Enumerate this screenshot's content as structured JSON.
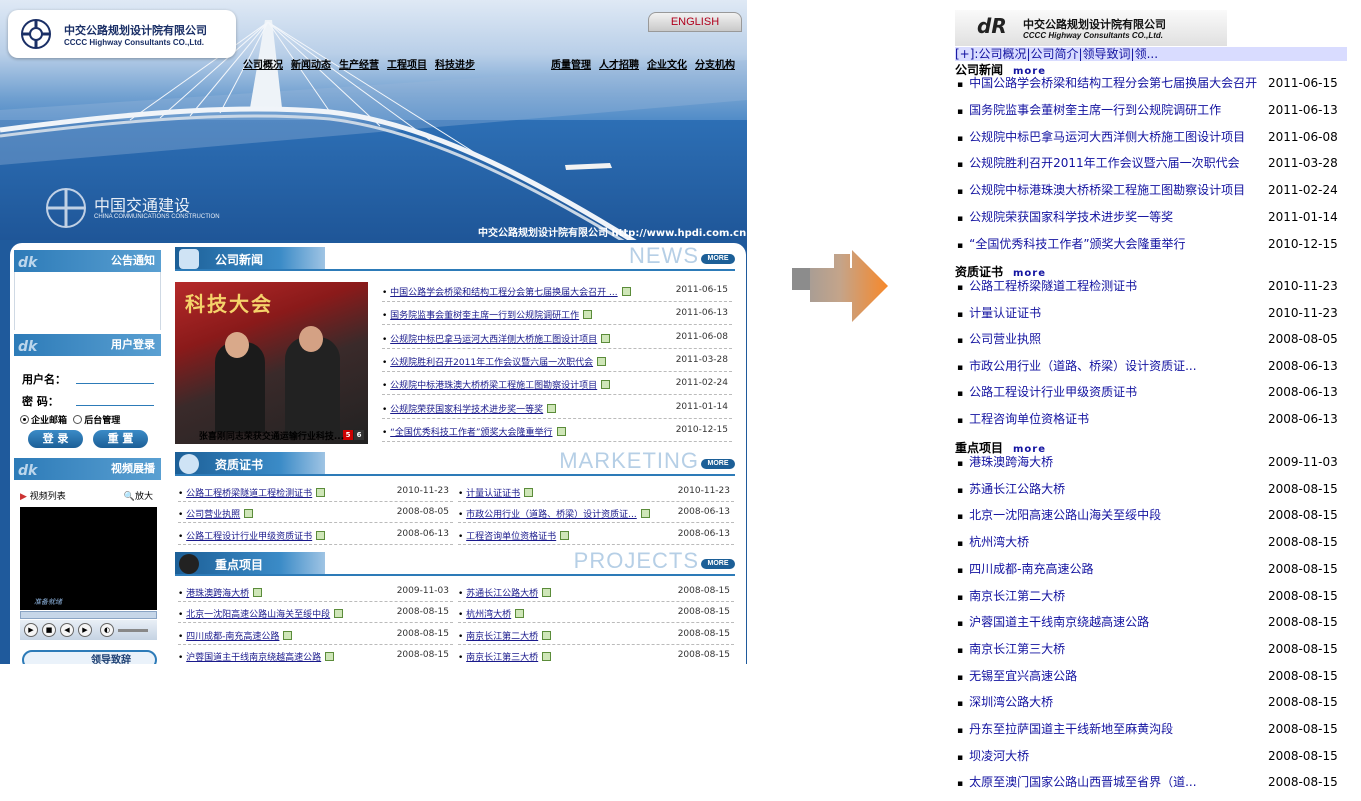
{
  "desktop": {
    "logo": {
      "cn": "中交公路规划设计院有限公司",
      "en": "CCCC Highway Consultants CO.,Ltd."
    },
    "english_button": "ENGLISH",
    "topnav_left": [
      "公司概况",
      "新闻动态",
      "生产经营",
      "工程项目",
      "科技进步"
    ],
    "topnav_right": [
      "质量管理",
      "人才招聘",
      "企业文化",
      "分支机构"
    ],
    "banner_brand": {
      "cn": "中国交通建设",
      "en": "CHINA COMMUNICATIONS CONSTRUCTION"
    },
    "banner_url": "中交公路规划设计院有限公司  http://www.hpdi.com.cn",
    "sidebar": {
      "notice_title": "公告通知",
      "login_title": "用户登录",
      "username_label": "用户名：",
      "password_label": "密  码：",
      "radio_mail": "企业邮箱",
      "radio_admin": "后台管理",
      "login_button": "登 录",
      "reset_button": "重 置",
      "video_title": "视频展播",
      "video_list": "视频列表",
      "video_zoom": "放大",
      "video_status": "准备就绪",
      "leader_title": "领导致辞"
    },
    "news": {
      "title": "公司新闻",
      "ghost": "NEWS",
      "more": "MORE",
      "photo_caption": "张喜刚同志荣获交通运输行业科技...",
      "photo_banner": "科技大会",
      "photo_pager": [
        "5",
        "6"
      ],
      "items": [
        {
          "title": "中国公路学会桥梁和结构工程分会第七届换届大会召开 ...",
          "date": "2011-06-15"
        },
        {
          "title": "国务院监事会董树奎主席一行到公规院调研工作",
          "date": "2011-06-13"
        },
        {
          "title": "公规院中标巴拿马运河大西洋侧大桥施工图设计项目",
          "date": "2011-06-08"
        },
        {
          "title": "公规院胜利召开2011年工作会议暨六届一次职代会",
          "date": "2011-03-28"
        },
        {
          "title": "公规院中标港珠澳大桥桥梁工程施工图勘察设计项目",
          "date": "2011-02-24"
        },
        {
          "title": "公规院荣获国家科学技术进步奖一等奖",
          "date": "2011-01-14"
        },
        {
          "title": "“全国优秀科技工作者”颁奖大会隆重举行",
          "date": "2010-12-15"
        }
      ]
    },
    "certs": {
      "title": "资质证书",
      "ghost": "MARKETING",
      "more": "MORE",
      "left": [
        {
          "title": "公路工程桥梁隧道工程检测证书",
          "date": "2010-11-23"
        },
        {
          "title": "公司营业执照",
          "date": "2008-08-05"
        },
        {
          "title": "公路工程设计行业甲级资质证书",
          "date": "2008-06-13"
        }
      ],
      "right": [
        {
          "title": "计量认证证书",
          "date": "2010-11-23"
        },
        {
          "title": "市政公用行业（道路、桥梁）设计资质证...",
          "date": "2008-06-13"
        },
        {
          "title": "工程咨询单位资格证书",
          "date": "2008-06-13"
        }
      ]
    },
    "projects": {
      "title": "重点项目",
      "ghost": "PROJECTS",
      "more": "MORE",
      "left": [
        {
          "title": "港珠澳跨海大桥",
          "date": "2009-11-03"
        },
        {
          "title": "北京一沈阳高速公路山海关至绥中段",
          "date": "2008-08-15"
        },
        {
          "title": "四川成都-南充高速公路",
          "date": "2008-08-15"
        },
        {
          "title": "沪蓉国道主干线南京绕越高速公路",
          "date": "2008-08-15"
        }
      ],
      "right": [
        {
          "title": "苏通长江公路大桥",
          "date": "2008-08-15"
        },
        {
          "title": "杭州湾大桥",
          "date": "2008-08-15"
        },
        {
          "title": "南京长江第二大桥",
          "date": "2008-08-15"
        },
        {
          "title": "南京长江第三大桥",
          "date": "2008-08-15"
        }
      ]
    }
  },
  "mobile": {
    "logo": {
      "cn": "中交公路规划设计院有限公司",
      "en": "CCCC Highway Consultants CO.,Ltd."
    },
    "menu": "[+]:公司概况|公司简介|领导致词|领...",
    "more": "more",
    "news_title": "公司新闻",
    "news": [
      {
        "title": "中国公路学会桥梁和结构工程分会第七届换届大会召开",
        "date": "2011-06-15"
      },
      {
        "title": "国务院监事会董树奎主席一行到公规院调研工作",
        "date": "2011-06-13"
      },
      {
        "title": "公规院中标巴拿马运河大西洋侧大桥施工图设计项目",
        "date": "2011-06-08"
      },
      {
        "title": "公规院胜利召开2011年工作会议暨六届一次职代会",
        "date": "2011-03-28"
      },
      {
        "title": "公规院中标港珠澳大桥桥梁工程施工图勘察设计项目",
        "date": "2011-02-24"
      },
      {
        "title": "公规院荣获国家科学技术进步奖一等奖",
        "date": "2011-01-14"
      },
      {
        "title": "“全国优秀科技工作者”颁奖大会隆重举行",
        "date": "2010-12-15"
      }
    ],
    "certs_title": "资质证书",
    "certs": [
      {
        "title": "公路工程桥梁隧道工程检测证书",
        "date": "2010-11-23"
      },
      {
        "title": "计量认证证书",
        "date": "2010-11-23"
      },
      {
        "title": "公司营业执照",
        "date": "2008-08-05"
      },
      {
        "title": "市政公用行业（道路、桥梁）设计资质证...",
        "date": "2008-06-13"
      },
      {
        "title": "公路工程设计行业甲级资质证书",
        "date": "2008-06-13"
      },
      {
        "title": "工程咨询单位资格证书",
        "date": "2008-06-13"
      }
    ],
    "projects_title": "重点项目",
    "projects": [
      {
        "title": "港珠澳跨海大桥",
        "date": "2009-11-03"
      },
      {
        "title": "苏通长江公路大桥",
        "date": "2008-08-15"
      },
      {
        "title": "北京一沈阳高速公路山海关至绥中段",
        "date": "2008-08-15"
      },
      {
        "title": "杭州湾大桥",
        "date": "2008-08-15"
      },
      {
        "title": "四川成都-南充高速公路",
        "date": "2008-08-15"
      },
      {
        "title": "南京长江第二大桥",
        "date": "2008-08-15"
      },
      {
        "title": "沪蓉国道主干线南京绕越高速公路",
        "date": "2008-08-15"
      },
      {
        "title": "南京长江第三大桥",
        "date": "2008-08-15"
      },
      {
        "title": "无锡至宜兴高速公路",
        "date": "2008-08-15"
      },
      {
        "title": "深圳湾公路大桥",
        "date": "2008-08-15"
      },
      {
        "title": "丹东至拉萨国道主干线新地至麻黄沟段",
        "date": "2008-08-15"
      },
      {
        "title": "坝凌河大桥",
        "date": "2008-08-15"
      },
      {
        "title": "太原至澳门国家公路山西晋城至省界（道...",
        "date": "2008-08-15"
      }
    ]
  }
}
